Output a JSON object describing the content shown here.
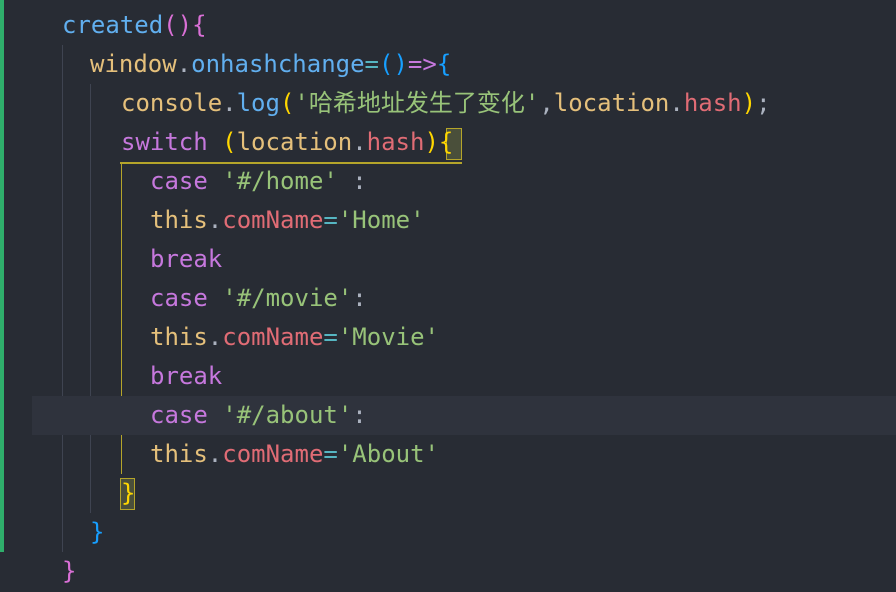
{
  "code": {
    "l1": {
      "a": "created",
      "b": "()",
      "c": "{"
    },
    "l2": {
      "a": "window",
      "b": ".",
      "c": "onhashchange",
      "d": "=",
      "e": "()",
      "f": "=>",
      "g": "{"
    },
    "l3": {
      "a": "console",
      "b": ".",
      "c": "log",
      "d": "(",
      "e": "'哈希地址发生了变化'",
      "f": ",",
      "g": "location",
      "h": ".",
      "i": "hash",
      "j": ")",
      "k": ";"
    },
    "l4": {
      "a": "switch",
      "b": " ",
      "c": "(",
      "d": "location",
      "e": ".",
      "f": "hash",
      "g": ")",
      "h": "{"
    },
    "l5": {
      "a": "case",
      "b": " ",
      "c": "'#/home'",
      "d": " :"
    },
    "l6": {
      "a": "this",
      "b": ".",
      "c": "comName",
      "d": "=",
      "e": "'Home'"
    },
    "l7": {
      "a": "break"
    },
    "l8": {
      "a": "case",
      "b": " ",
      "c": "'#/movie'",
      "d": ":"
    },
    "l9": {
      "a": "this",
      "b": ".",
      "c": "comName",
      "d": "=",
      "e": "'Movie'"
    },
    "l10": {
      "a": "break"
    },
    "l11": {
      "a": "case",
      "b": " ",
      "c": "'#/about'",
      "d": ":"
    },
    "l12": {
      "a": "this",
      "b": ".",
      "c": "comName",
      "d": "=",
      "e": "'About'"
    },
    "l13": {
      "a": "}"
    },
    "l14": {
      "a": "}"
    },
    "l15": {
      "a": "}"
    }
  },
  "colors": {
    "background": "#282c34",
    "git_modified_bar": "#2fae6b",
    "active_guide": "#b5a52a",
    "string": "#98c379",
    "keyword": "#c678dd",
    "property": "#e06c75",
    "function": "#61afef"
  }
}
